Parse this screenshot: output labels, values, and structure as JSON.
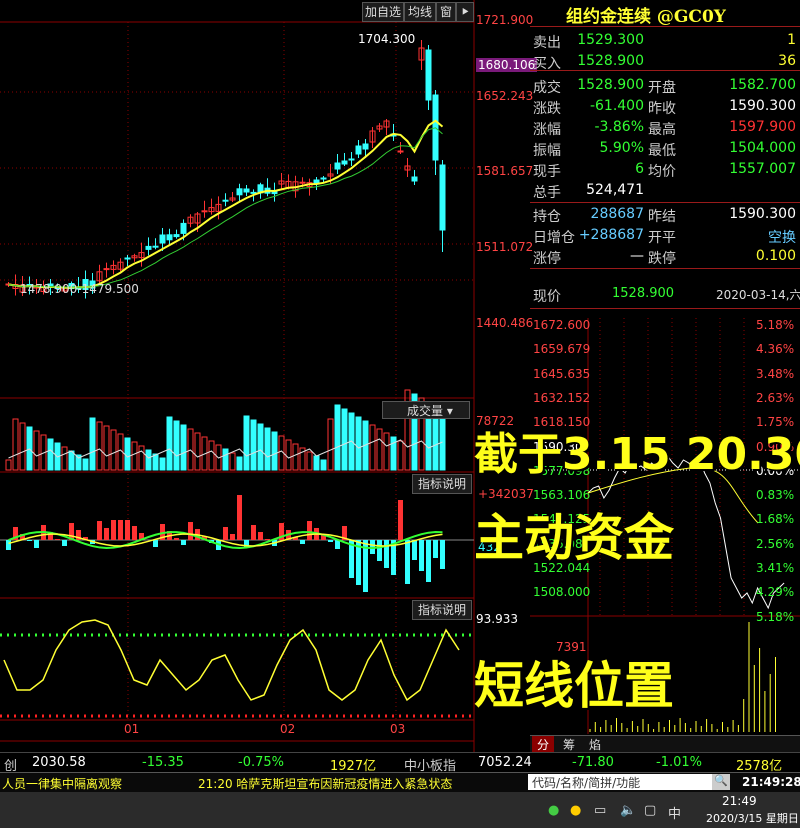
{
  "toolbar": {
    "add_watch": "加自选",
    "ma_line": "均线",
    "window": "窗",
    "pin_icon": "pin-icon"
  },
  "title": "组约金连续 @GC0Y",
  "quote": {
    "rows": [
      {
        "l1": "卖出",
        "v1": "1529.300",
        "c1": "#33ff33",
        "l2": "",
        "v2": "1",
        "c2": "#ffff33"
      },
      {
        "l1": "买入",
        "v1": "1528.900",
        "c1": "#33ff33",
        "l2": "",
        "v2": "36",
        "c2": "#ffff33"
      },
      {
        "l1": "成交",
        "v1": "1528.900",
        "c1": "#33ff33",
        "l2": "开盘",
        "v2": "1582.700",
        "c2": "#33ff33"
      },
      {
        "l1": "涨跌",
        "v1": "-61.400",
        "c1": "#33ff33",
        "l2": "昨收",
        "v2": "1590.300",
        "c2": "#ffffff"
      },
      {
        "l1": "涨幅",
        "v1": "-3.86%",
        "c1": "#33ff33",
        "l2": "最高",
        "v2": "1597.900",
        "c2": "#ff3333"
      },
      {
        "l1": "振幅",
        "v1": "5.90%",
        "c1": "#33ff33",
        "l2": "最低",
        "v2": "1504.000",
        "c2": "#33ff33"
      },
      {
        "l1": "现手",
        "v1": "6",
        "c1": "#33ff33",
        "l2": "均价",
        "v2": "1557.007",
        "c2": "#33ff33"
      },
      {
        "l1": "总手",
        "v1": "524,471",
        "c1": "#ffffff",
        "l2": "",
        "v2": "",
        "c2": "#ffffff"
      },
      {
        "l1": "持仓",
        "v1": "288687",
        "c1": "#66ccff",
        "l2": "昨结",
        "v2": "1590.300",
        "c2": "#ffffff"
      },
      {
        "l1": "日增仓",
        "v1": "+288687",
        "c1": "#66ccff",
        "l2": "开平",
        "v2": "空换",
        "c2": "#66ccff"
      },
      {
        "l1": "涨停",
        "v1": "—",
        "c1": "#ffffff",
        "l2": "跌停",
        "v2": "0.100",
        "c2": "#ffff33"
      }
    ],
    "current_label": "现价",
    "current_price": "1528.900",
    "date": "2020-03-14,六"
  },
  "kline": {
    "high_label": "1704.300",
    "low_label": "1478.900-1479.500",
    "y_labels": [
      "1721.900",
      "1652.243",
      "1581.657",
      "1511.072",
      "1440.486"
    ],
    "last_price": "1680.106",
    "volume_label": "成交量",
    "volume_value": "78722",
    "indicator_btn": "指标说明",
    "ind_value1": "+342037",
    "ind_value2": "432",
    "ind_value3": "93.933",
    "x_labels": [
      "01",
      "02",
      "03"
    ]
  },
  "timeshare": {
    "prices": [
      "1672.600",
      "1659.679",
      "1645.635",
      "1632.152",
      "1618.150",
      "1590.300",
      "1577.098",
      "1563.106",
      "1549.125",
      "1536.089",
      "1522.044",
      "1508.000"
    ],
    "percents": [
      "5.18%",
      "4.36%",
      "3.48%",
      "2.63%",
      "1.75%",
      "0.90%",
      "0.00%",
      "0.83%",
      "1.68%",
      "2.56%",
      "3.41%",
      "4.29%",
      "5.18%"
    ],
    "vol_label": "7391",
    "tabs": [
      "分",
      "筹",
      "焰"
    ]
  },
  "overlay": {
    "line1": "截于3.15 20.30",
    "line2": "主动资金",
    "line3": "短线位置"
  },
  "index_bar": {
    "name1": "创",
    "v1": "2030.58",
    "c1": "-15.35",
    "p1": "-0.75%",
    "amt1": "1927亿",
    "name2": "中小板指",
    "v2": "7052.24",
    "c2": "-71.80",
    "p2": "-1.01%",
    "amt2": "2578亿"
  },
  "news": {
    "left": "人员一律集中隔离观察",
    "middle": "21:20 哈萨克斯坦宣布因新冠疫情进入紧急状态",
    "search": "代码/名称/简拼/功能",
    "time": "21:49:28"
  },
  "taskbar": {
    "time": "21:49",
    "date": "2020/3/15 星期日",
    "ime": "中"
  },
  "colors": {
    "up": "#ff3333",
    "down": "#33ffff",
    "ma5": "#ffff33",
    "ma10": "#33cc33",
    "grid": "#8b0000"
  }
}
